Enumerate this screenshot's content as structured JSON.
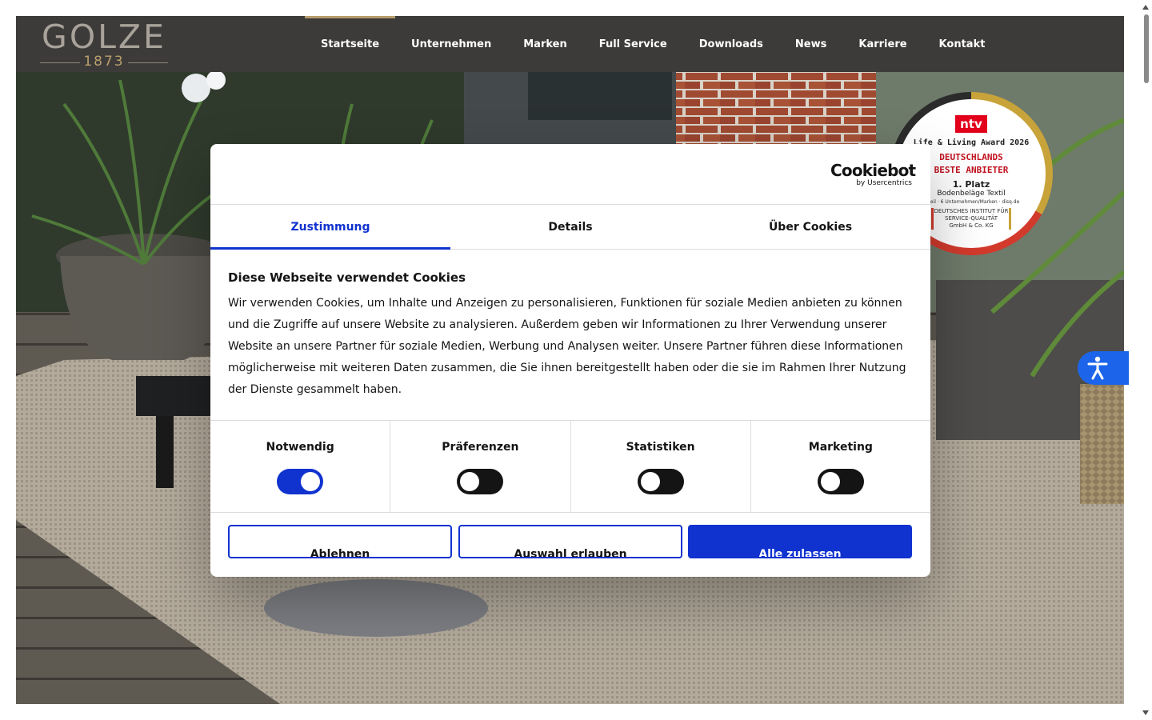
{
  "logo": {
    "word": "GOLZE",
    "year": "1873"
  },
  "nav": {
    "items": [
      "Startseite",
      "Unternehmen",
      "Marken",
      "Full Service",
      "Downloads",
      "News",
      "Karriere",
      "Kontakt"
    ],
    "active": "Startseite"
  },
  "badge": {
    "brand": "ntv",
    "line1": "Life & Living Award 2026",
    "line2": "DEUTSCHLANDS",
    "line3": "BESTE ANBIETER",
    "rank": "1. Platz",
    "category": "Bodenbeläge Textil",
    "fine": "Urteil · 6 Unternehmen/Marken · disq.de",
    "institute": "DEUTSCHES INSTITUT FÜR SERVICE-QUALITÄT",
    "institute_sub": "GmbH & Co. KG"
  },
  "cookie": {
    "logo_word": "Cookiebot",
    "logo_sub": "by Usercentrics",
    "tabs": [
      "Zustimmung",
      "Details",
      "Über Cookies"
    ],
    "active_tab": "Zustimmung",
    "title": "Diese Webseite verwendet Cookies",
    "text": "Wir verwenden Cookies, um Inhalte und Anzeigen zu personalisieren, Funktionen für soziale Medien anbieten zu können und die Zugriffe auf unsere Website zu analysieren. Außerdem geben wir Informationen zu Ihrer Verwendung unserer Website an unsere Partner für soziale Medien, Werbung und Analysen weiter. Unsere Partner führen diese Informationen möglicherweise mit weiteren Daten zusammen, die Sie ihnen bereitgestellt haben oder die sie im Rahmen Ihrer Nutzung der Dienste gesammelt haben.",
    "categories": [
      {
        "label": "Notwendig",
        "enabled": true
      },
      {
        "label": "Präferenzen",
        "enabled": false
      },
      {
        "label": "Statistiken",
        "enabled": false
      },
      {
        "label": "Marketing",
        "enabled": false
      }
    ],
    "buttons": {
      "deny": "Ablehnen",
      "allow_selection": "Auswahl erlauben",
      "allow_all": "Alle zulassen"
    }
  },
  "icons": {
    "accessibility": "accessibility-icon"
  },
  "colors": {
    "accent": "#1032cf",
    "header_bg": "#3d3b39",
    "nav_active": "#b69d6c",
    "a11y": "#1c65ea"
  }
}
